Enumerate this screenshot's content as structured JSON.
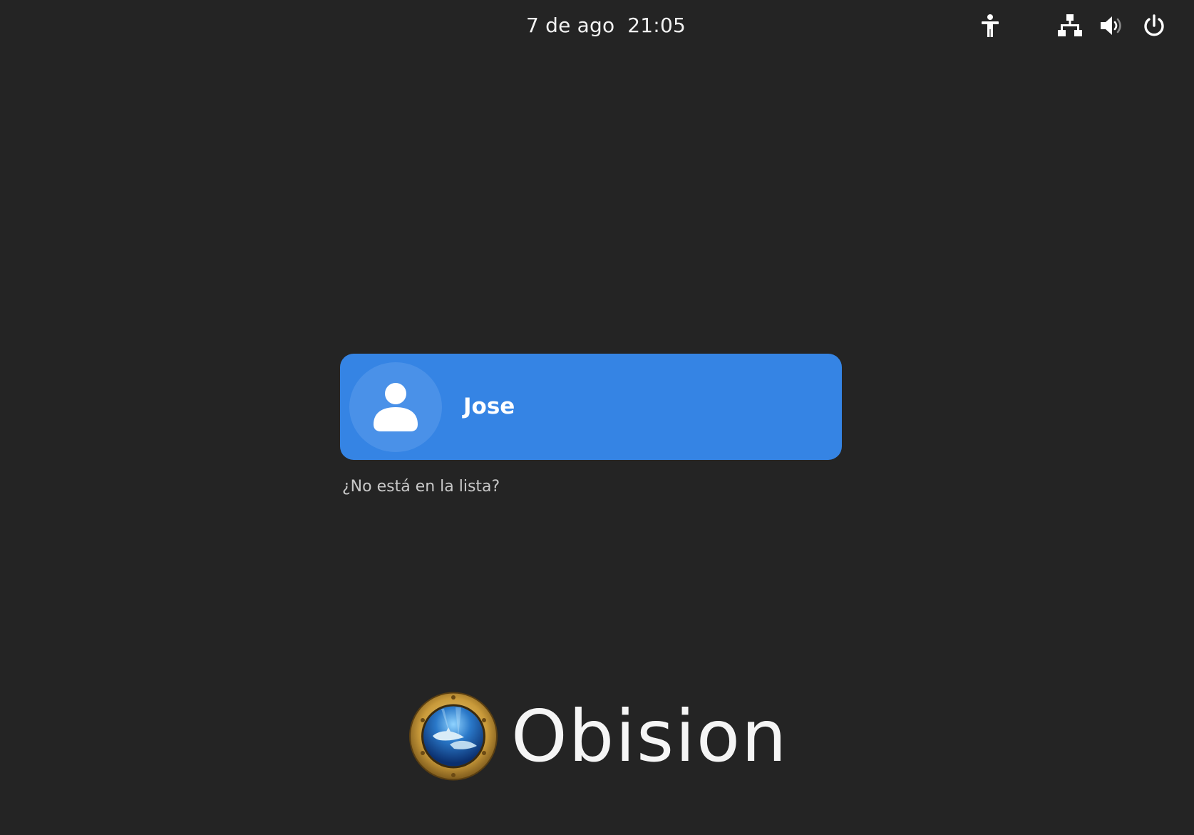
{
  "top_bar": {
    "date": "7 de ago",
    "time": "21:05",
    "icons": [
      "accessibility-icon",
      "network-wired-icon",
      "volume-icon",
      "power-icon"
    ]
  },
  "user_list": {
    "users": [
      {
        "name": "Jose",
        "avatar_icon": "user-avatar-icon"
      }
    ],
    "not_listed_label": "¿No está en la lista?"
  },
  "branding": {
    "logo_icon": "porthole-dolphins-logo",
    "name": "Obision"
  },
  "colors": {
    "background": "#242424",
    "user_card": "#3584e4",
    "avatar_circle": "#4a91e8",
    "text": "#ffffff",
    "secondary_text": "#c8c8c8"
  }
}
